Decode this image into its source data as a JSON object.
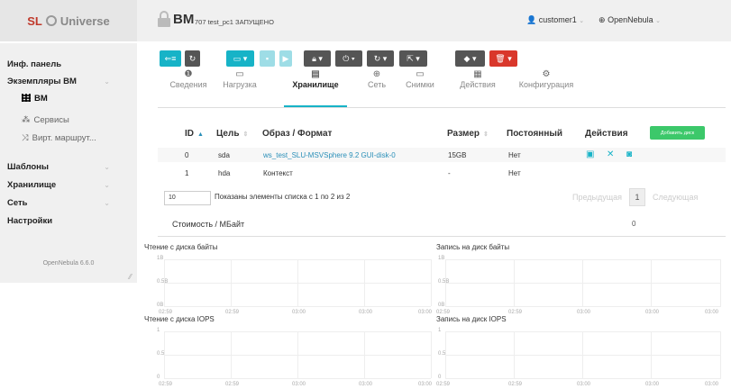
{
  "brand": {
    "sl": "SL",
    "universe": "Universe"
  },
  "header": {
    "vm_title": "ВМ",
    "vm_subtitle": "707 test_pc1 ЗАПУЩЕНО",
    "user": "customer1",
    "cloud": "OpenNebula"
  },
  "sidebar": {
    "items": [
      {
        "label": "Инф. панель"
      },
      {
        "label": "Экземпляры ВМ"
      },
      {
        "label": "ВМ"
      },
      {
        "label": "Сервисы"
      },
      {
        "label": "Вирт. маршрут..."
      },
      {
        "label": "Шаблоны"
      },
      {
        "label": "Хранилище"
      },
      {
        "label": "Сеть"
      },
      {
        "label": "Настройки"
      }
    ],
    "version": "OpenNebula 6.6.0"
  },
  "tabs": [
    {
      "label": "Сведения",
      "icon": "info-icon"
    },
    {
      "label": "Нагрузка",
      "icon": "monitor-icon"
    },
    {
      "label": "Хранилище",
      "icon": "storage-icon"
    },
    {
      "label": "Сеть",
      "icon": "globe-icon"
    },
    {
      "label": "Снимки",
      "icon": "monitor-icon"
    },
    {
      "label": "Действия",
      "icon": "calendar-icon"
    },
    {
      "label": "Конфигурация",
      "icon": "cogs-icon"
    }
  ],
  "table": {
    "headers": [
      "ID",
      "Цель",
      "Образ / Формат",
      "Размер",
      "Постоянный",
      "Действия"
    ],
    "add_disk": "Добавить диск",
    "rows": [
      {
        "id": "0",
        "target": "sda",
        "image": "ws_test_SLU-MSVSphere 9.2 GUI-disk-0",
        "size": "15GB",
        "persistent": "Нет"
      },
      {
        "id": "1",
        "target": "hda",
        "image": "Контекст",
        "size": "-",
        "persistent": "Нет"
      }
    ]
  },
  "pagination": {
    "page_size": "10",
    "info": "Показаны элементы списка с 1 по 2 из 2",
    "prev": "Предыдущая",
    "page": "1",
    "next": "Следующая"
  },
  "cost": {
    "label": "Стоимость / МБайт",
    "value": "0"
  },
  "charts": {
    "read_bytes": {
      "title": "Чтение с диска байты",
      "y": [
        "1B",
        "0.5B",
        "0B"
      ]
    },
    "write_bytes": {
      "title": "Запись на диск байты",
      "y": [
        "1B",
        "0.5B",
        "0B"
      ]
    },
    "read_iops": {
      "title": "Чтение с диска IOPS",
      "y": [
        "1",
        "0.5",
        "0"
      ]
    },
    "write_iops": {
      "title": "Запись на диск IOPS",
      "y": [
        "1",
        "0.5",
        "0"
      ]
    },
    "x": [
      "02:59",
      "02:59",
      "03:00",
      "03:00",
      "03:00"
    ]
  },
  "colors": {
    "accent": "#17b3c7",
    "danger": "#d9372b",
    "success": "#3cc86a"
  }
}
